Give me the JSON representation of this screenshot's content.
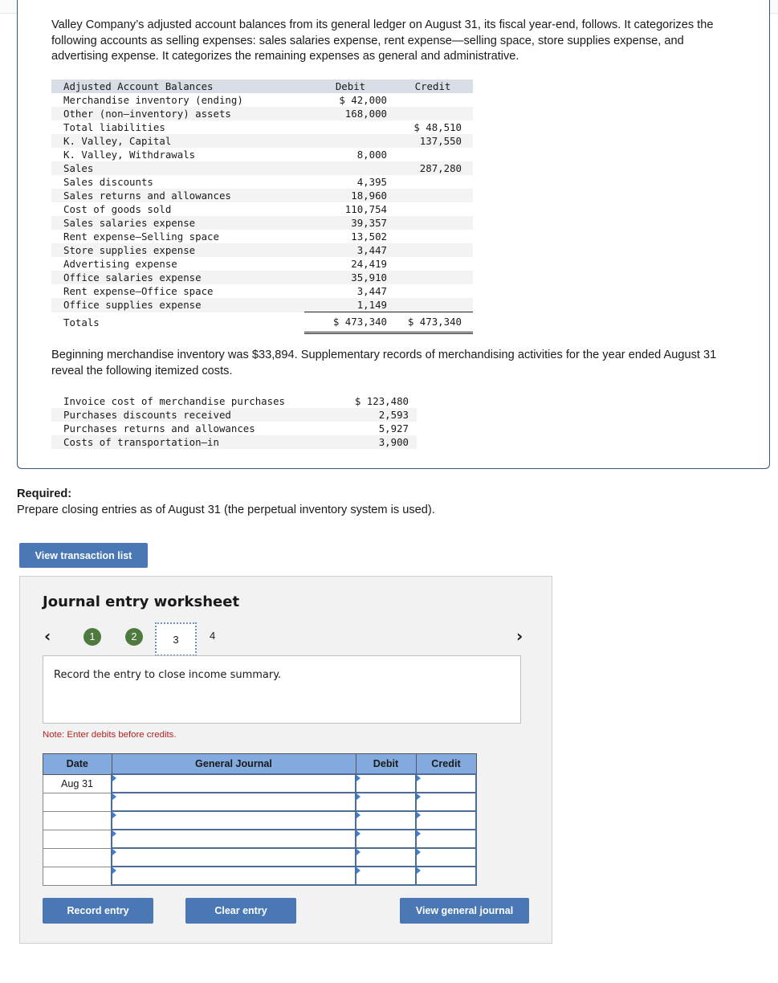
{
  "intro": "Valley Company’s adjusted account balances from its general ledger on August 31, its fiscal year-end, follows. It categorizes the following accounts as selling expenses: sales salaries expense, rent expense—selling space, store supplies expense, and advertising expense. It categorizes the remaining expenses as general and administrative.",
  "balances": {
    "headers": {
      "label": "Adjusted Account Balances",
      "debit": "Debit",
      "credit": "Credit"
    },
    "rows": [
      {
        "label": "Merchandise inventory (ending)",
        "debit": "$ 42,000",
        "credit": ""
      },
      {
        "label": "Other (non–inventory) assets",
        "debit": "168,000",
        "credit": ""
      },
      {
        "label": "Total liabilities",
        "debit": "",
        "credit": "$ 48,510"
      },
      {
        "label": "K. Valley, Capital",
        "debit": "",
        "credit": "137,550"
      },
      {
        "label": "K. Valley, Withdrawals",
        "debit": "8,000",
        "credit": ""
      },
      {
        "label": "Sales",
        "debit": "",
        "credit": "287,280"
      },
      {
        "label": "Sales discounts",
        "debit": "4,395",
        "credit": ""
      },
      {
        "label": "Sales returns and allowances",
        "debit": "18,960",
        "credit": ""
      },
      {
        "label": "Cost of goods sold",
        "debit": "110,754",
        "credit": ""
      },
      {
        "label": "Sales salaries expense",
        "debit": "39,357",
        "credit": ""
      },
      {
        "label": "Rent expense—Selling space",
        "debit": "13,502",
        "credit": ""
      },
      {
        "label": "Store supplies expense",
        "debit": "3,447",
        "credit": ""
      },
      {
        "label": "Advertising expense",
        "debit": "24,419",
        "credit": ""
      },
      {
        "label": "Office salaries expense",
        "debit": "35,910",
        "credit": ""
      },
      {
        "label": "Rent expense—Office space",
        "debit": "3,447",
        "credit": ""
      },
      {
        "label": "Office supplies expense",
        "debit": "1,149",
        "credit": ""
      }
    ],
    "totals": {
      "label": "Totals",
      "debit": "$ 473,340",
      "credit": "$ 473,340"
    }
  },
  "para2": "Beginning merchandise inventory was $33,894. Supplementary records of merchandising activities for the year ended August 31 reveal the following itemized costs.",
  "supplementary": [
    {
      "label": "Invoice cost of merchandise purchases",
      "value": "$ 123,480"
    },
    {
      "label": "Purchases discounts received",
      "value": "2,593"
    },
    {
      "label": "Purchases returns and allowances",
      "value": "5,927"
    },
    {
      "label": "Costs of transportation–in",
      "value": "3,900"
    }
  ],
  "required": {
    "title": "Required:",
    "text": "Prepare closing entries as of August 31 (the perpetual inventory system is used)."
  },
  "view_transaction_list": "View transaction list",
  "worksheet": {
    "title": "Journal entry worksheet",
    "steps": [
      "1",
      "2",
      "3",
      "4"
    ],
    "current_step": "3",
    "instruction": "Record the entry to close income summary.",
    "note": "Note: Enter debits before credits.",
    "table": {
      "headers": {
        "date": "Date",
        "journal": "General Journal",
        "debit": "Debit",
        "credit": "Credit"
      },
      "rows": [
        {
          "date": "Aug 31",
          "journal": "",
          "debit": "",
          "credit": ""
        },
        {
          "date": "",
          "journal": "",
          "debit": "",
          "credit": ""
        },
        {
          "date": "",
          "journal": "",
          "debit": "",
          "credit": ""
        },
        {
          "date": "",
          "journal": "",
          "debit": "",
          "credit": ""
        },
        {
          "date": "",
          "journal": "",
          "debit": "",
          "credit": ""
        },
        {
          "date": "",
          "journal": "",
          "debit": "",
          "credit": ""
        }
      ]
    },
    "buttons": {
      "record": "Record entry",
      "clear": "Clear entry",
      "view_journal": "View general journal"
    }
  }
}
